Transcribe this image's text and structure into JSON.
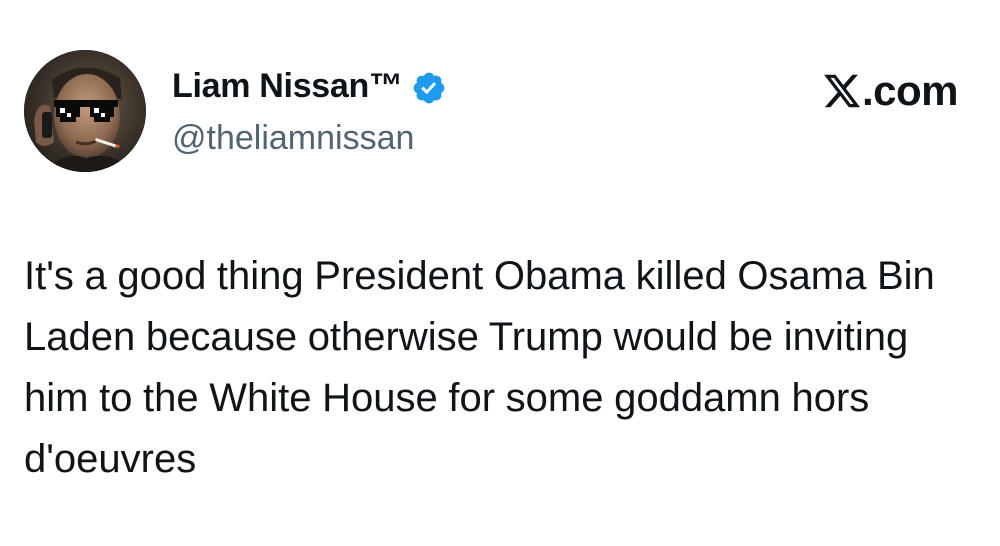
{
  "tweet": {
    "author": {
      "display_name": "Liam Nissan™",
      "handle": "@theliamnissan",
      "verified": true,
      "avatar_icon": "sunglasses-portrait-icon"
    },
    "brand": {
      "text": ".com",
      "logo_icon": "x-logo-icon"
    },
    "text": "It's a good thing President Obama killed Osama Bin Laden because otherwise Trump would be inviting him to the White House for some goddamn hors d'oeuvres"
  },
  "colors": {
    "text_primary": "#0f1419",
    "text_secondary": "#536471",
    "verified_blue": "#1d9bf0",
    "background": "#ffffff"
  }
}
